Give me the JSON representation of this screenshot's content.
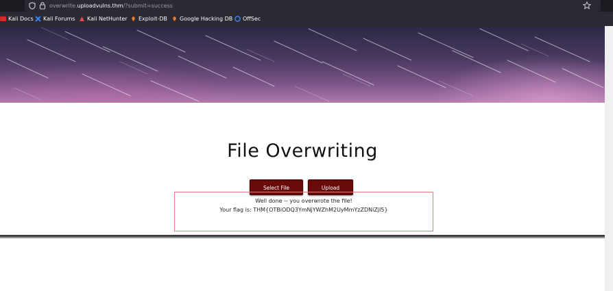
{
  "browser": {
    "url_prefix": "overwrite.",
    "url_host": "uploadvulns.thm",
    "url_path": "/?submit=success"
  },
  "bookmarks": [
    {
      "label": "Kali Docs",
      "icon": "kali-docs-icon",
      "color": "#d62828"
    },
    {
      "label": "Kali Forums",
      "icon": "kali-forums-icon",
      "color": "#3b82f6"
    },
    {
      "label": "Kali NetHunter",
      "icon": "kali-nethunter-icon",
      "color": "#e84a4a"
    },
    {
      "label": "Exploit-DB",
      "icon": "exploit-db-icon",
      "color": "#f07b2a"
    },
    {
      "label": "Google Hacking DB",
      "icon": "ghdb-icon",
      "color": "#f07b2a"
    },
    {
      "label": "OffSec",
      "icon": "offsec-icon",
      "color": "#3b7ddd"
    }
  ],
  "main": {
    "title": "File Overwriting",
    "select_button": "Select File",
    "upload_button": "Upload",
    "message_line1": "Well done -- you overwrote the file!",
    "message_line2": "Your flag is: THM{OTBiODQ3YmNjYWZhM2UyMmYzZDNiZjI5}"
  },
  "colors": {
    "button": "#6b0a0a",
    "message_border": "#e8797e"
  }
}
